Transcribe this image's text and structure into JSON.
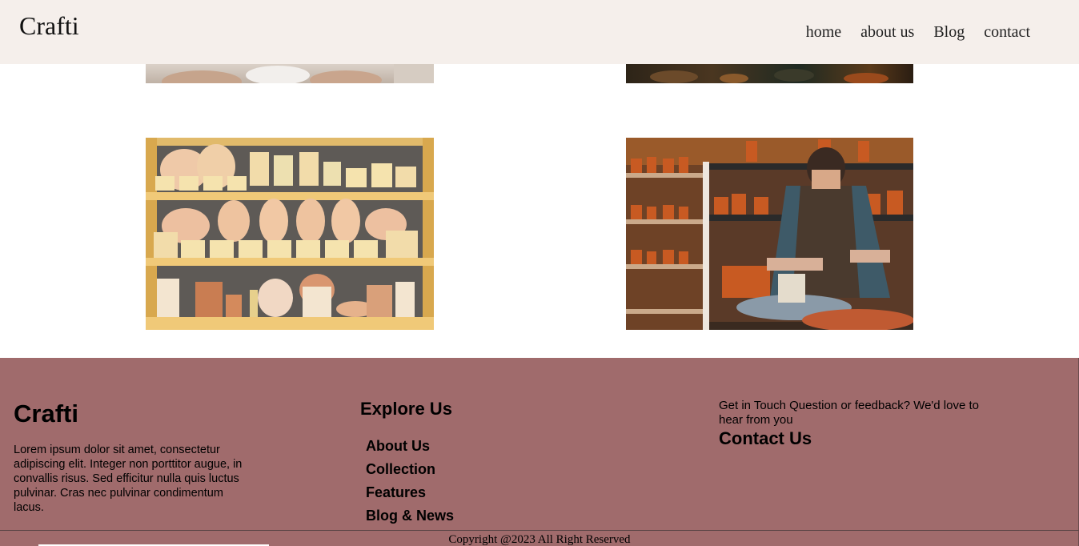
{
  "header": {
    "brand": "Crafti",
    "nav": [
      "home",
      "about us",
      "Blog",
      "contact"
    ]
  },
  "gallery": {
    "images": [
      "pottery-hands-photo",
      "workshop-photo",
      "ceramic-shelves-photo",
      "potter-wheel-photo"
    ]
  },
  "footer": {
    "brand": "Crafti",
    "description": "Lorem ipsum dolor sit amet, consectetur adipiscing elit. Integer non porttitor augue, in convallis risus. Sed efficitur nulla quis luctus pulvinar. Cras nec pulvinar condimentum lacus.",
    "explore_title": "Explore Us",
    "links": [
      "About Us",
      "Collection",
      "Features",
      "Blog & News"
    ],
    "touch_text": "Get in Touch Question or feedback? We'd love to hear from you",
    "contact_title": "Contact Us",
    "copyright": "Copyright @2023 All Right Reserved"
  },
  "colors": {
    "header_bg": "#f5efeb",
    "footer_bg": "#a06b6c"
  }
}
